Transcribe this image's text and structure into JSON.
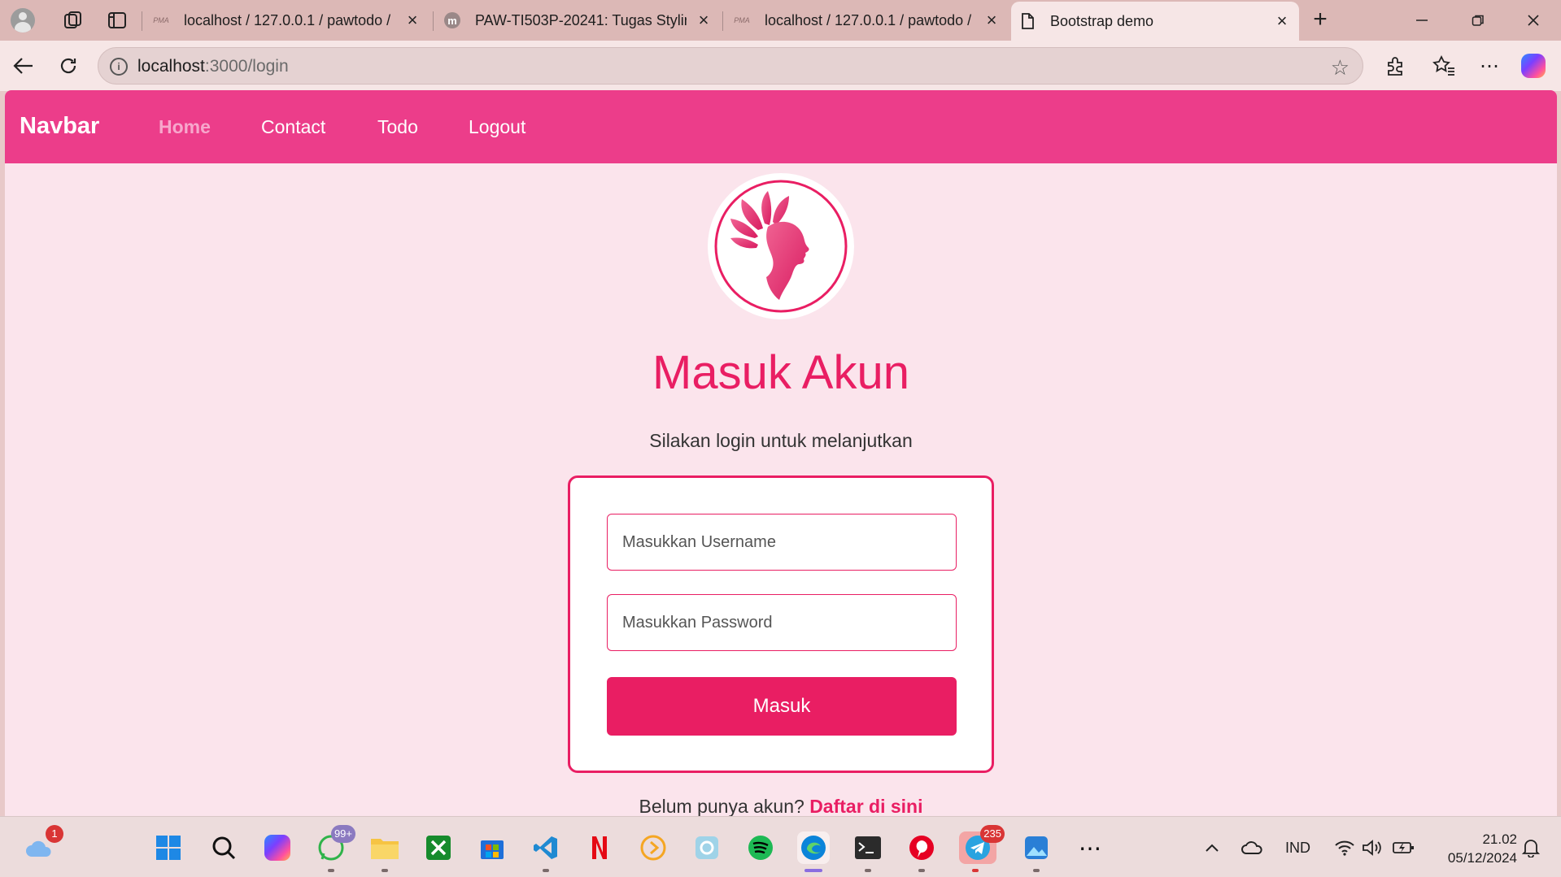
{
  "browser": {
    "tabs": [
      {
        "title": "localhost / 127.0.0.1 / pawtodo / ",
        "favicon": "phpmyadmin-icon",
        "fav_text": "PMA"
      },
      {
        "title": "PAW-TI503P-20241: Tugas Styling",
        "favicon": "moodle-icon",
        "fav_text": "m"
      },
      {
        "title": "localhost / 127.0.0.1 / pawtodo / ",
        "favicon": "phpmyadmin-icon",
        "fav_text": "PMA"
      },
      {
        "title": "Bootstrap demo",
        "favicon": "page-icon",
        "fav_text": ""
      }
    ],
    "address": {
      "host": "localhost",
      "path": ":3000/login"
    }
  },
  "page": {
    "navbar": {
      "brand": "Navbar",
      "links": [
        "Home",
        "Contact",
        "Todo",
        "Logout"
      ],
      "active_link": "Home"
    },
    "heading": "Masuk Akun",
    "subheading": "Silakan login untuk melanjutkan",
    "form": {
      "username_placeholder": "Masukkan Username",
      "password_placeholder": "Masukkan Password",
      "submit_label": "Masuk"
    },
    "register": {
      "prompt": "Belum punya akun?",
      "link": "Daftar di sini"
    },
    "colors": {
      "navbar": "#ec3d8a",
      "accent": "#e91e63",
      "background": "#fbe4ec"
    }
  },
  "taskbar": {
    "weather_badge": "1",
    "whatsapp_badge": "99+",
    "telegram_badge": "235",
    "language": "IND",
    "time": "21.02",
    "date": "05/12/2024"
  }
}
